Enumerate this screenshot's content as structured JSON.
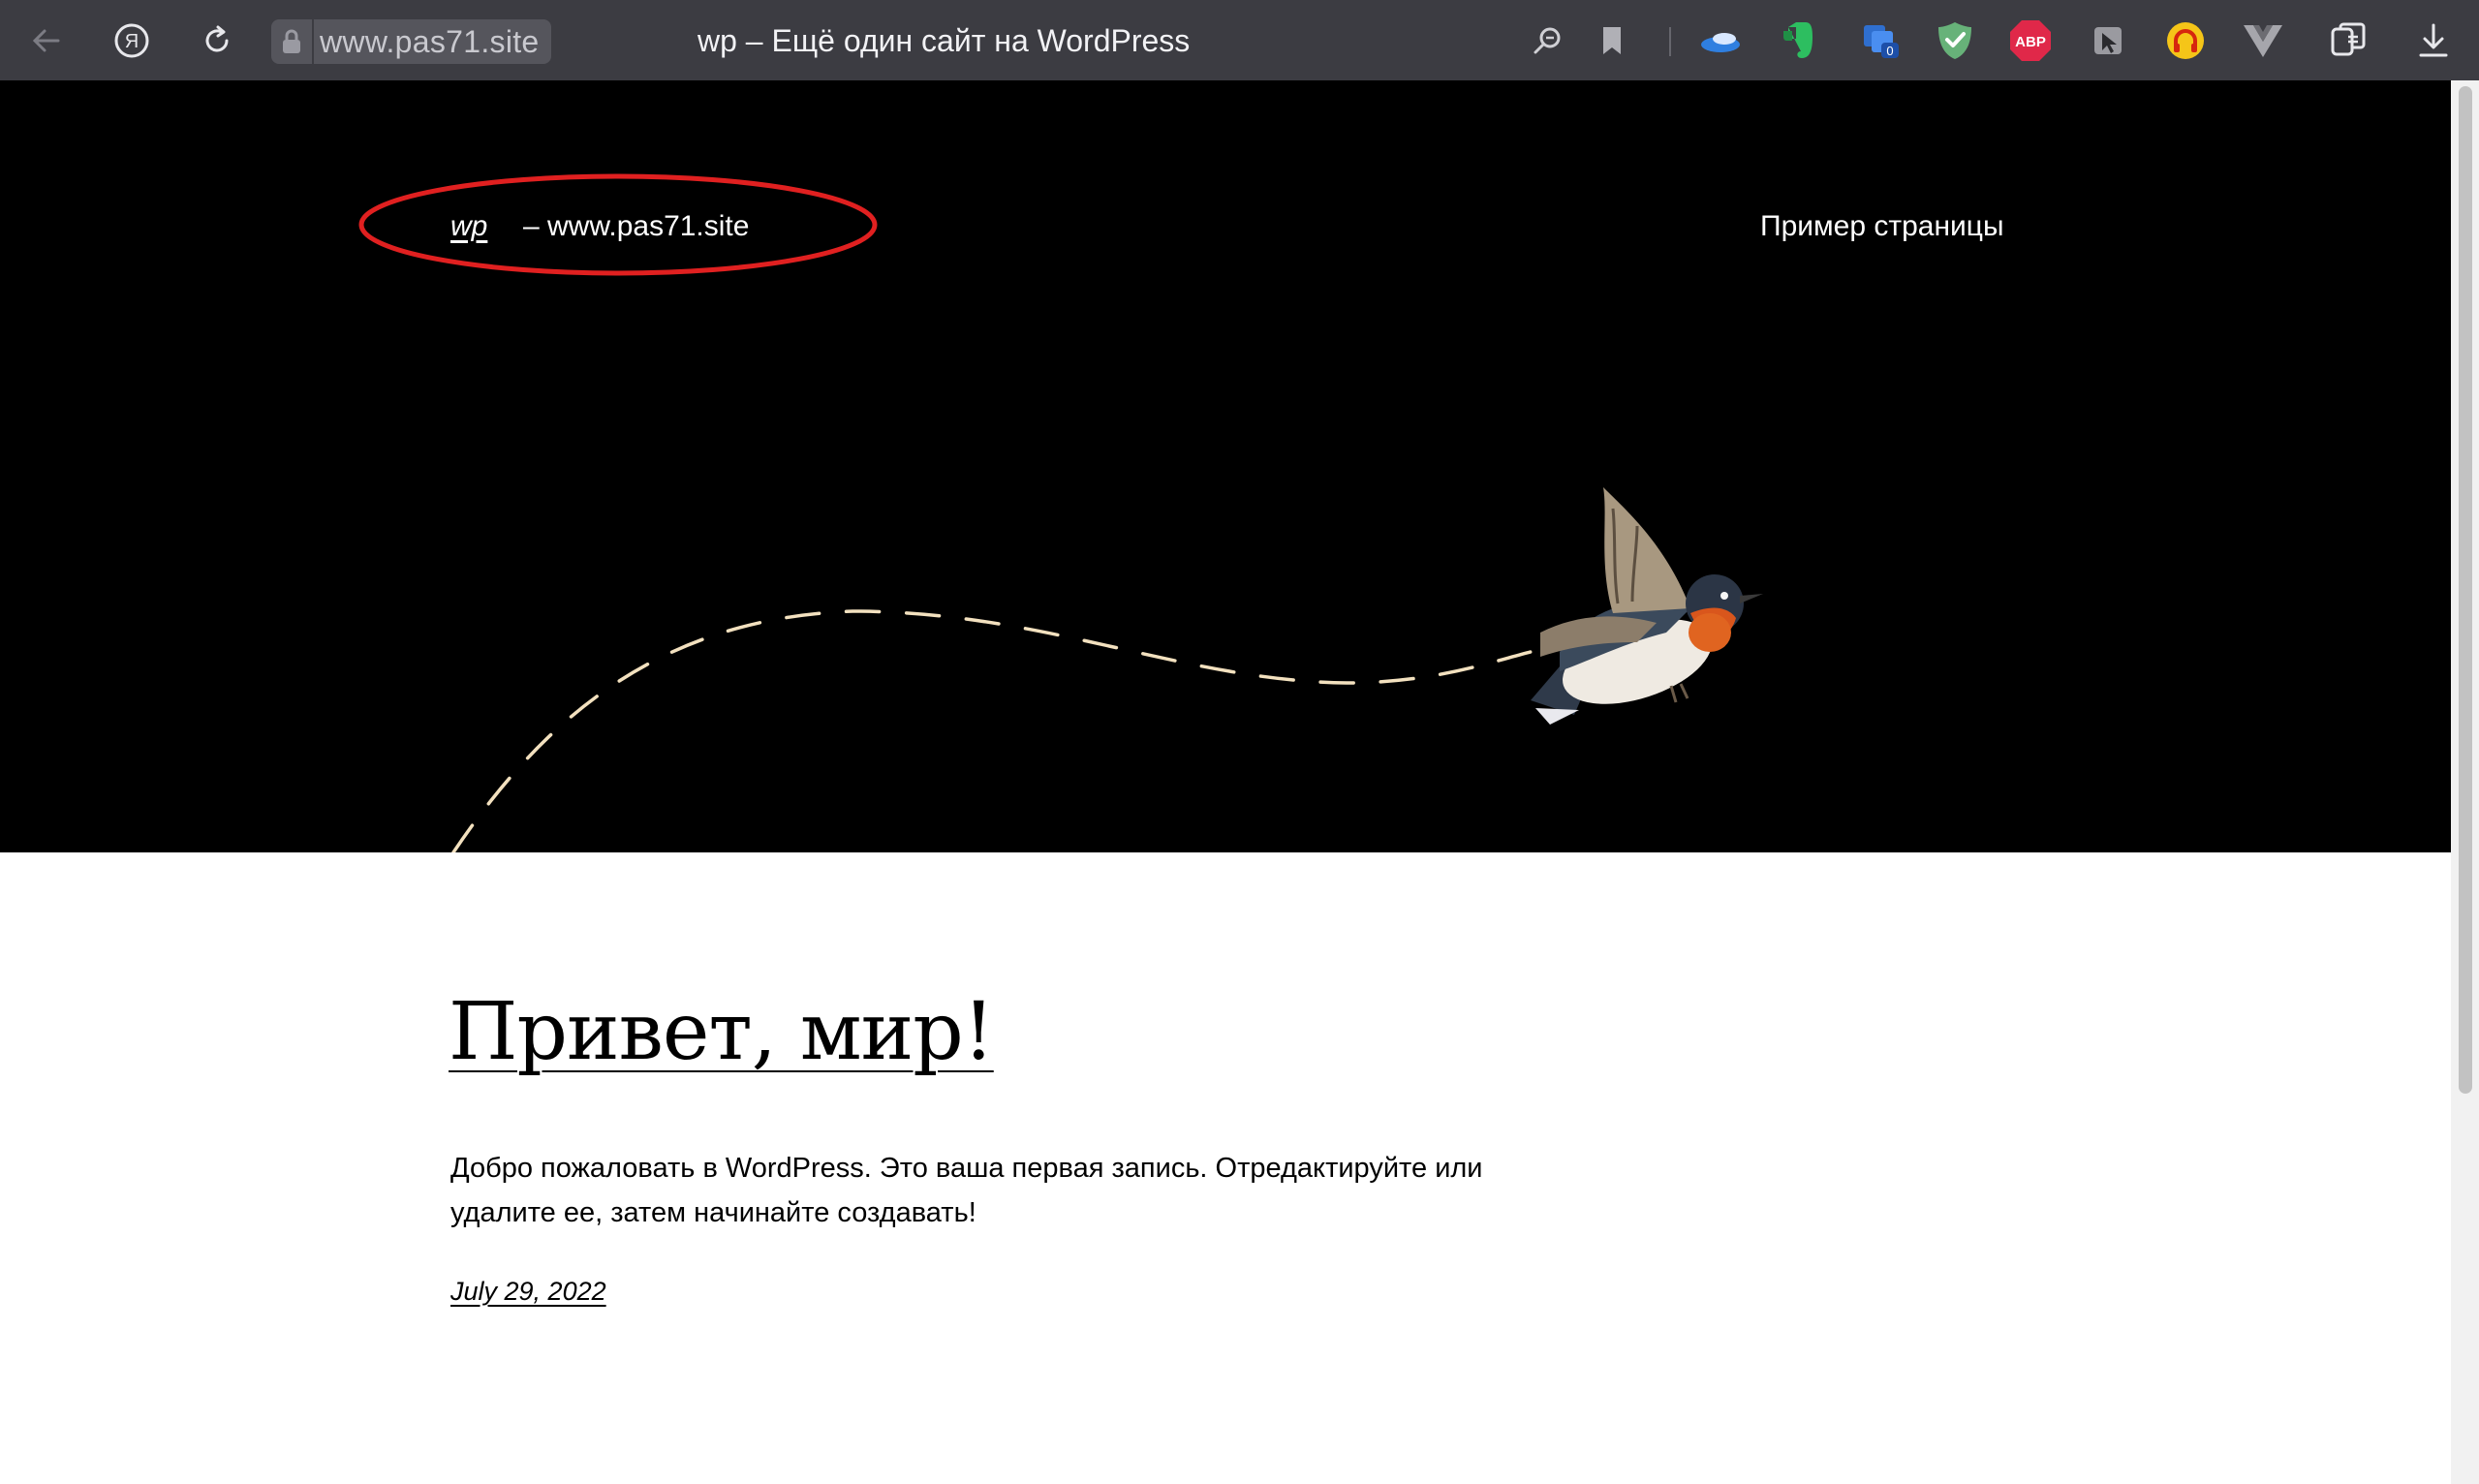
{
  "browser": {
    "url": "www.pas71.site",
    "tab_title": "wp – Ещё один сайт на WordPress",
    "extensions": [
      "weather-icon",
      "evernote-icon",
      "tab-counter-icon",
      "adguard-icon",
      "adblock-plus-icon",
      "cursor-extension-icon",
      "headphones-extension-icon",
      "vue-devtools-icon"
    ],
    "extension_badges": {
      "tab_counter": "0",
      "adblock": "ABP"
    }
  },
  "site": {
    "title": "wp",
    "tagline": "– www.pas71.site",
    "nav": [
      {
        "label": "Пример страницы"
      }
    ]
  },
  "post": {
    "title": "Привет, мир!",
    "body": "Добро пожаловать в WordPress. Это ваша первая запись. Отредактируйте или удалите ее, затем начинайте создавать!",
    "date": "July 29, 2022"
  },
  "colors": {
    "toolbar": "#3c3c42",
    "hero_background": "#000000",
    "annotation": "#e02020",
    "dash_line": "#f3e1bf"
  }
}
